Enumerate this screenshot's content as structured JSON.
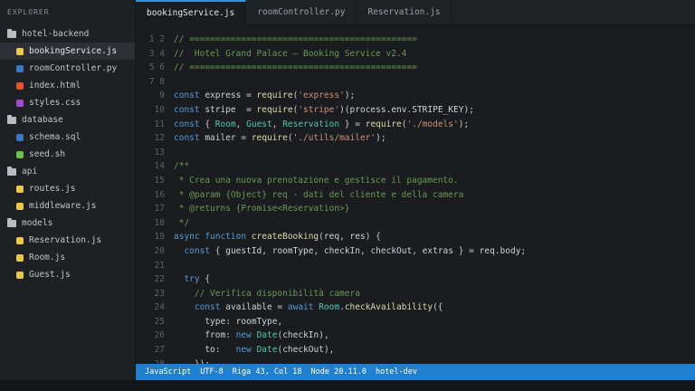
{
  "sidebar": {
    "title": "EXPLORER",
    "tree": [
      {
        "type": "folder",
        "label": "hotel-backend",
        "color": "#b8bcc3"
      },
      {
        "type": "file",
        "label": "bookingService.js",
        "color": "#e9c84a",
        "active": true
      },
      {
        "type": "file",
        "label": "roomController.py",
        "color": "#3b78c2"
      },
      {
        "type": "file",
        "label": "index.html",
        "color": "#e0572c"
      },
      {
        "type": "file",
        "label": "styles.css",
        "color": "#a24bd1"
      },
      {
        "type": "folder",
        "label": "database",
        "color": "#b8bcc3"
      },
      {
        "type": "file",
        "label": "schema.sql",
        "color": "#3b78c2"
      },
      {
        "type": "file",
        "label": "seed.sh",
        "color": "#6cc24a"
      },
      {
        "type": "folder",
        "label": "api",
        "color": "#b8bcc3"
      },
      {
        "type": "file",
        "label": "routes.js",
        "color": "#e9c84a"
      },
      {
        "type": "file",
        "label": "middleware.js",
        "color": "#e9c84a"
      },
      {
        "type": "folder",
        "label": "models",
        "color": "#b8bcc3"
      },
      {
        "type": "file",
        "label": "Reservation.js",
        "color": "#e9c84a"
      },
      {
        "type": "file",
        "label": "Room.js",
        "color": "#e9c84a"
      },
      {
        "type": "file",
        "label": "Guest.js",
        "color": "#e9c84a"
      }
    ]
  },
  "tabs": [
    {
      "label": "bookingService.js",
      "active": true
    },
    {
      "label": "roomController.py",
      "active": false
    },
    {
      "label": "Reservation.js",
      "active": false
    }
  ],
  "code_lines": [
    {
      "n": "1 2",
      "tokens": [
        [
          "comment",
          "// ============================================"
        ]
      ]
    },
    {
      "n": "3 4",
      "tokens": [
        [
          "comment",
          "//  Hotel Grand Palace — Booking Service v2.4"
        ]
      ]
    },
    {
      "n": "5 6",
      "tokens": [
        [
          "comment",
          "// ============================================"
        ]
      ]
    },
    {
      "n": "7 8",
      "tokens": []
    },
    {
      "n": "9",
      "tokens": [
        [
          "keyword",
          "const "
        ],
        [
          "ident",
          "express"
        ],
        [
          "plain",
          " = "
        ],
        [
          "func",
          "require"
        ],
        [
          "punct",
          "("
        ],
        [
          "string",
          "'express'"
        ],
        [
          "punct",
          ");"
        ]
      ]
    },
    {
      "n": "10",
      "tokens": [
        [
          "keyword",
          "const "
        ],
        [
          "ident",
          "stripe"
        ],
        [
          "plain",
          "  = "
        ],
        [
          "func",
          "require"
        ],
        [
          "punct",
          "("
        ],
        [
          "string",
          "'stripe'"
        ],
        [
          "punct",
          ")("
        ],
        [
          "ident",
          "process"
        ],
        [
          "punct",
          "."
        ],
        [
          "ident",
          "env"
        ],
        [
          "punct",
          "."
        ],
        [
          "ident",
          "STRIPE_KEY"
        ],
        [
          "punct",
          ");"
        ]
      ]
    },
    {
      "n": "11",
      "tokens": [
        [
          "keyword",
          "const "
        ],
        [
          "punct",
          "{ "
        ],
        [
          "class",
          "Room"
        ],
        [
          "punct",
          ", "
        ],
        [
          "class",
          "Guest"
        ],
        [
          "punct",
          ", "
        ],
        [
          "class",
          "Reservation"
        ],
        [
          "punct",
          " } "
        ],
        [
          "plain",
          "= "
        ],
        [
          "func",
          "require"
        ],
        [
          "punct",
          "("
        ],
        [
          "string",
          "'./models'"
        ],
        [
          "punct",
          ");"
        ]
      ]
    },
    {
      "n": "12",
      "tokens": [
        [
          "keyword",
          "const "
        ],
        [
          "ident",
          "mailer"
        ],
        [
          "plain",
          " = "
        ],
        [
          "func",
          "require"
        ],
        [
          "punct",
          "("
        ],
        [
          "string",
          "'./utils/mailer'"
        ],
        [
          "punct",
          ");"
        ]
      ]
    },
    {
      "n": "13",
      "tokens": []
    },
    {
      "n": "14",
      "tokens": [
        [
          "comment",
          "/**"
        ]
      ]
    },
    {
      "n": "15",
      "tokens": [
        [
          "comment",
          " * Crea una nuova prenotazione e gestisce il pagamento."
        ]
      ]
    },
    {
      "n": "16",
      "tokens": [
        [
          "comment",
          " * @param {Object} req - dati del cliente e della camera"
        ]
      ]
    },
    {
      "n": "17",
      "tokens": [
        [
          "comment",
          " * @returns {Promise<Reservation>}"
        ]
      ]
    },
    {
      "n": "18",
      "tokens": [
        [
          "comment",
          " */"
        ]
      ]
    },
    {
      "n": "19",
      "tokens": [
        [
          "keyword",
          "async function "
        ],
        [
          "func",
          "createBooking"
        ],
        [
          "punct",
          "("
        ],
        [
          "ident",
          "req"
        ],
        [
          "punct",
          ", "
        ],
        [
          "ident",
          "res"
        ],
        [
          "punct",
          ") {"
        ]
      ]
    },
    {
      "n": "20",
      "tokens": [
        [
          "plain",
          "  "
        ],
        [
          "keyword",
          "const "
        ],
        [
          "punct",
          "{ "
        ],
        [
          "ident",
          "guestId"
        ],
        [
          "punct",
          ", "
        ],
        [
          "ident",
          "roomType"
        ],
        [
          "punct",
          ", "
        ],
        [
          "ident",
          "checkIn"
        ],
        [
          "punct",
          ", "
        ],
        [
          "ident",
          "checkOut"
        ],
        [
          "punct",
          ", "
        ],
        [
          "ident",
          "extras"
        ],
        [
          "punct",
          " } "
        ],
        [
          "plain",
          "= "
        ],
        [
          "ident",
          "req"
        ],
        [
          "punct",
          "."
        ],
        [
          "ident",
          "body"
        ],
        [
          "punct",
          ";"
        ]
      ]
    },
    {
      "n": "21",
      "tokens": []
    },
    {
      "n": "22",
      "tokens": [
        [
          "plain",
          "  "
        ],
        [
          "keyword",
          "try "
        ],
        [
          "punct",
          "{"
        ]
      ]
    },
    {
      "n": "23",
      "tokens": [
        [
          "plain",
          "    "
        ],
        [
          "comment",
          "// Verifica disponibilità camera"
        ]
      ]
    },
    {
      "n": "24",
      "tokens": [
        [
          "plain",
          "    "
        ],
        [
          "keyword",
          "const "
        ],
        [
          "ident",
          "available"
        ],
        [
          "plain",
          " = "
        ],
        [
          "keyword",
          "await "
        ],
        [
          "class",
          "Room"
        ],
        [
          "punct",
          "."
        ],
        [
          "func",
          "checkAvailability"
        ],
        [
          "punct",
          "({"
        ]
      ]
    },
    {
      "n": "25",
      "tokens": [
        [
          "plain",
          "      "
        ],
        [
          "ident",
          "type"
        ],
        [
          "punct",
          ": "
        ],
        [
          "ident",
          "roomType"
        ],
        [
          "punct",
          ","
        ]
      ]
    },
    {
      "n": "26",
      "tokens": [
        [
          "plain",
          "      "
        ],
        [
          "ident",
          "from"
        ],
        [
          "punct",
          ": "
        ],
        [
          "keyword",
          "new "
        ],
        [
          "class",
          "Date"
        ],
        [
          "punct",
          "("
        ],
        [
          "ident",
          "checkIn"
        ],
        [
          "punct",
          "),"
        ]
      ]
    },
    {
      "n": "27",
      "tokens": [
        [
          "plain",
          "      "
        ],
        [
          "ident",
          "to"
        ],
        [
          "punct",
          ":   "
        ],
        [
          "keyword",
          "new "
        ],
        [
          "class",
          "Date"
        ],
        [
          "punct",
          "("
        ],
        [
          "ident",
          "checkOut"
        ],
        [
          "punct",
          "),"
        ]
      ]
    },
    {
      "n": "28",
      "tokens": [
        [
          "plain",
          "    "
        ],
        [
          "punct",
          "});"
        ]
      ]
    }
  ],
  "statusbar": {
    "language": "JavaScript",
    "encoding": "UTF-8",
    "position": "Riga 43, Col 18",
    "runtime": "Node 20.11.0",
    "branch": "hotel-dev"
  }
}
